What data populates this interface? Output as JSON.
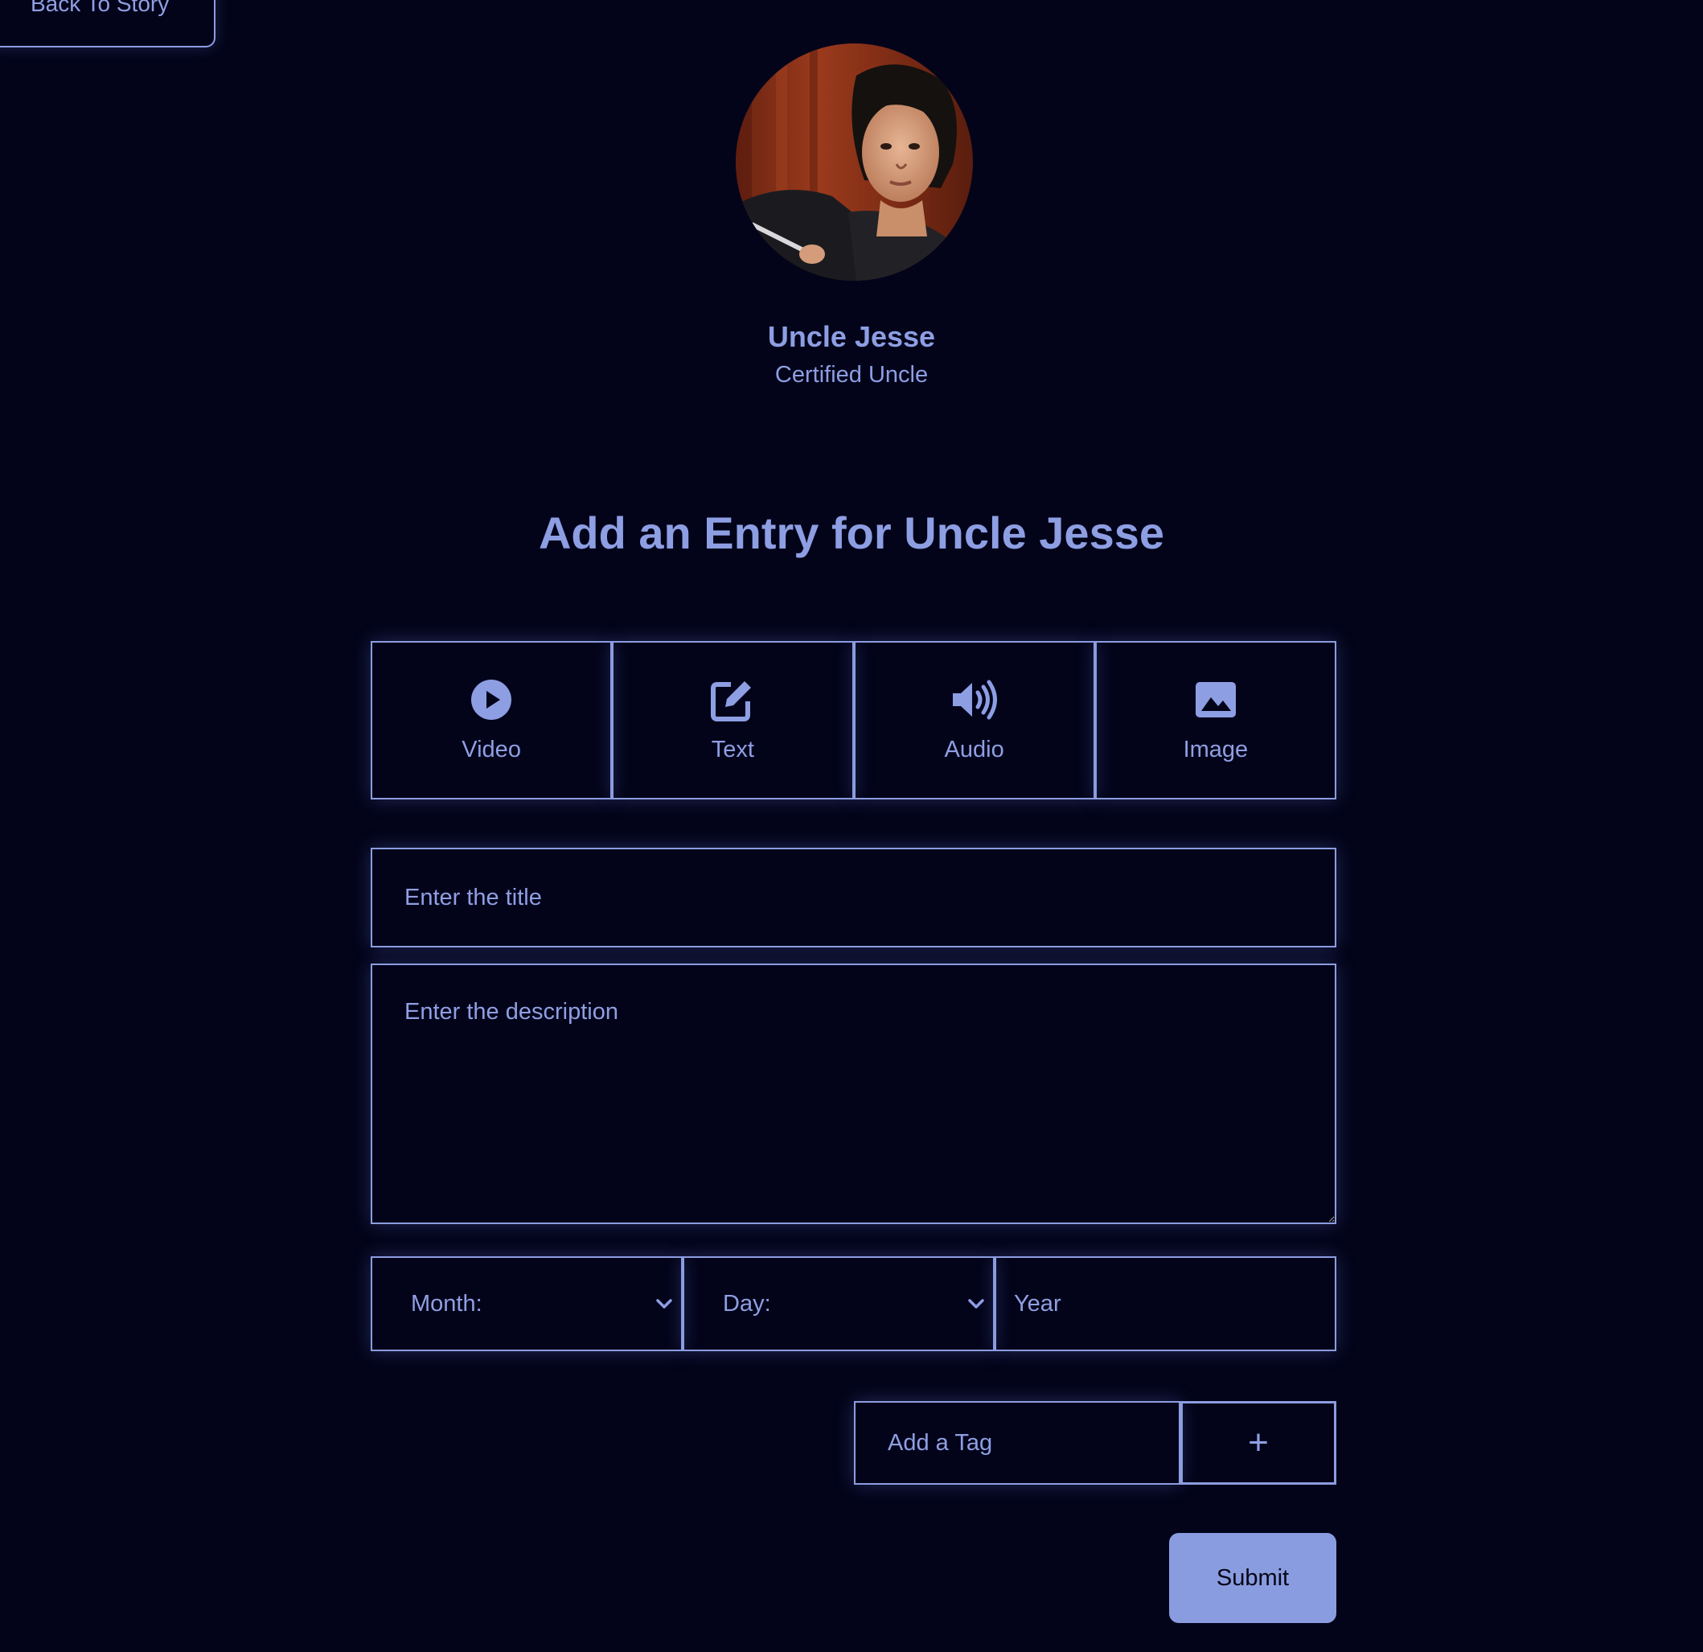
{
  "nav": {
    "back_label": "Back To Story"
  },
  "profile": {
    "name": "Uncle Jesse",
    "subtitle": "Certified Uncle",
    "avatar_alt": "Uncle Jesse"
  },
  "page": {
    "title": "Add an Entry for Uncle Jesse"
  },
  "entry_types": [
    {
      "label": "Video",
      "icon": "play-circle-icon"
    },
    {
      "label": "Text",
      "icon": "edit-icon"
    },
    {
      "label": "Audio",
      "icon": "volume-icon"
    },
    {
      "label": "Image",
      "icon": "image-icon"
    }
  ],
  "form": {
    "title_placeholder": "Enter the title",
    "description_placeholder": "Enter the description",
    "month_label": "Month:",
    "day_label": "Day:",
    "year_placeholder": "Year",
    "tag_placeholder": "Add a Tag",
    "tag_add_label": "+",
    "submit_label": "Submit"
  },
  "colors": {
    "background": "#03041a",
    "accent": "#8c9de0",
    "submit_bg": "#8a9ce0"
  }
}
